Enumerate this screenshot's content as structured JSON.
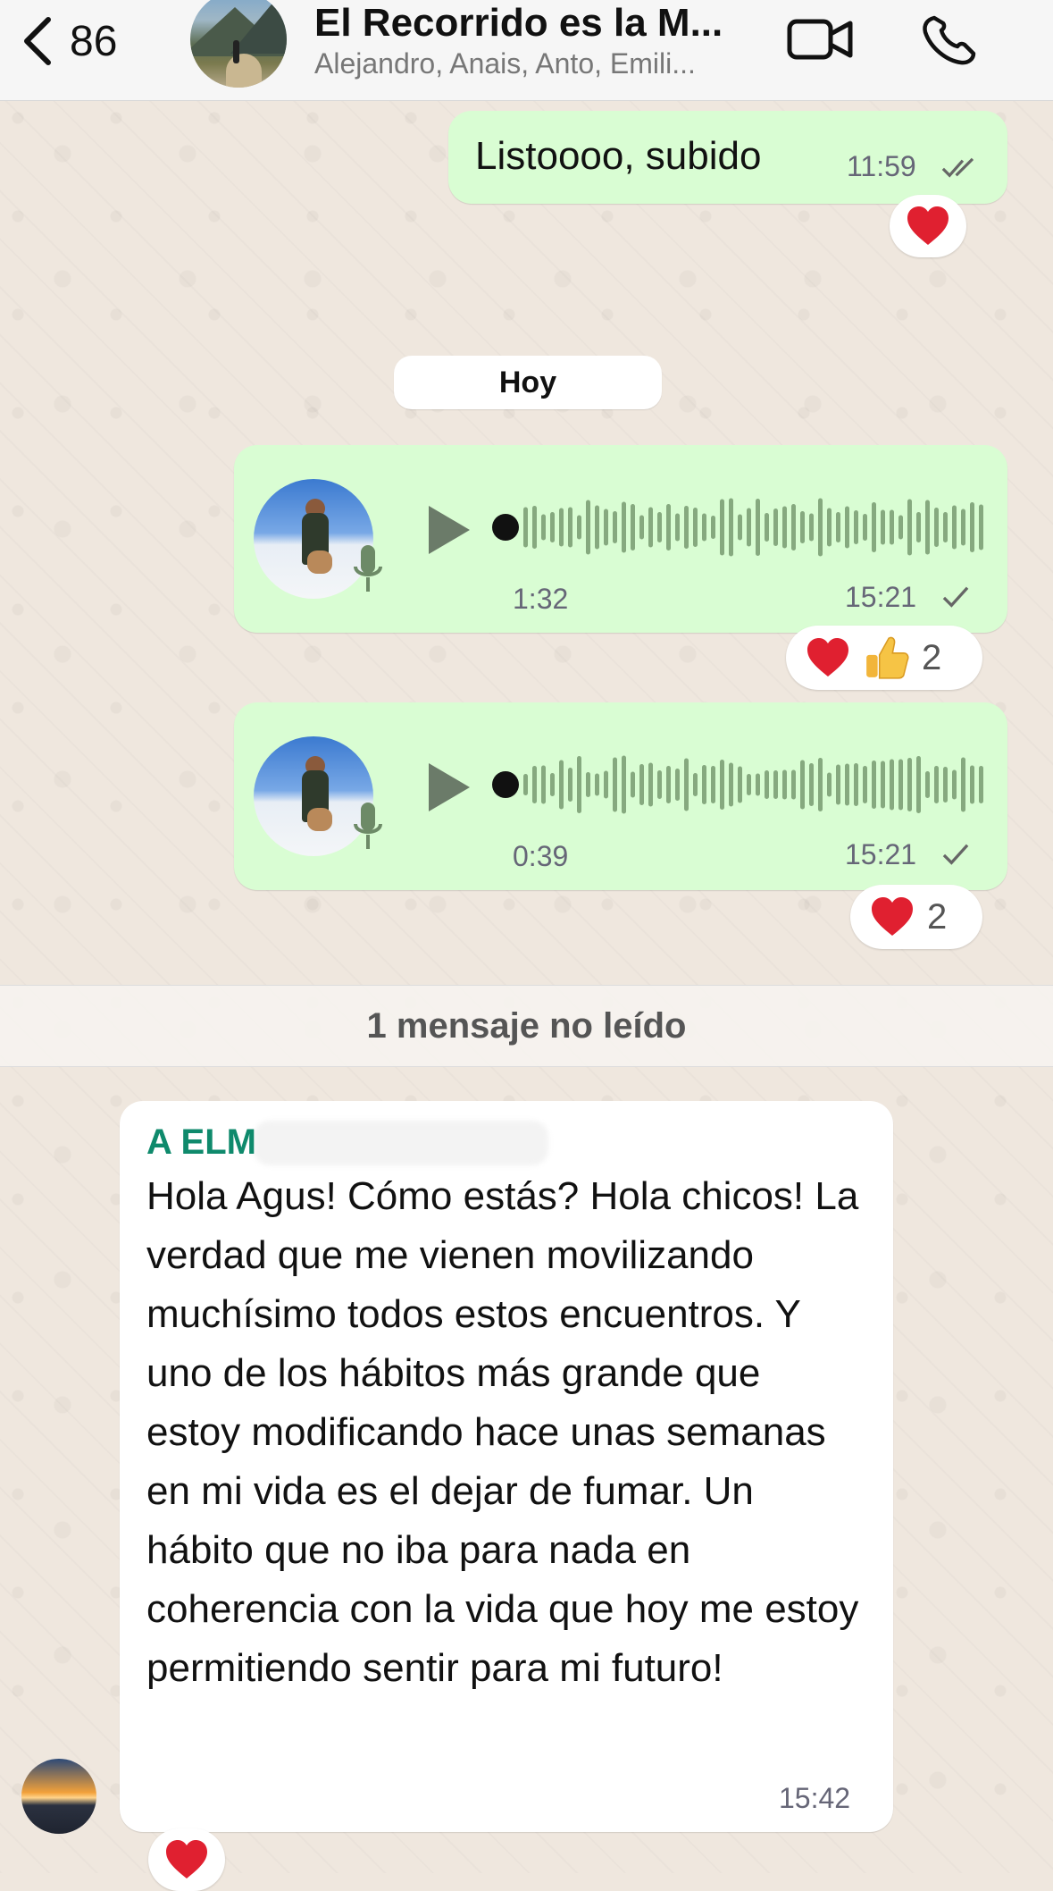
{
  "header": {
    "back_count": "86",
    "title": "El Recorrido es la M...",
    "members": "Alejandro, Anais, Anto, Emili..."
  },
  "messages": {
    "first": {
      "text": "Listoooo, subido",
      "time": "11:59",
      "reaction": "heart"
    },
    "date_chip": "Hoy",
    "voice1": {
      "duration": "1:32",
      "time": "15:21",
      "reaction_count": "2"
    },
    "voice2": {
      "duration": "0:39",
      "time": "15:21",
      "reaction_count": "2"
    },
    "unread_label": "1 mensaje no leído",
    "incoming": {
      "sender": "A            ELM",
      "text": "Hola Agus! Cómo estás? Hola chicos! La verdad que me vienen movilizando muchísimo todos estos encuentros. Y uno de los hábitos más grande que estoy modificando hace unas semanas en mi vida es el dejar de fumar. Un hábito que no iba para nada en coherencia con la vida que hoy me estoy permitiendo sentir para mi futuro!",
      "time": "15:42",
      "reaction": "heart"
    }
  },
  "colors": {
    "outgoing_bubble": "#d9fdd3",
    "incoming_bubble": "#ffffff",
    "sender_name": "#0f8a6c",
    "wallpaper": "#efe7de"
  },
  "icons": [
    "chevron-left-icon",
    "video-call-icon",
    "phone-icon",
    "play-icon",
    "mic-icon",
    "double-check-icon",
    "check-icon",
    "heart-icon",
    "thumbs-up-icon"
  ]
}
